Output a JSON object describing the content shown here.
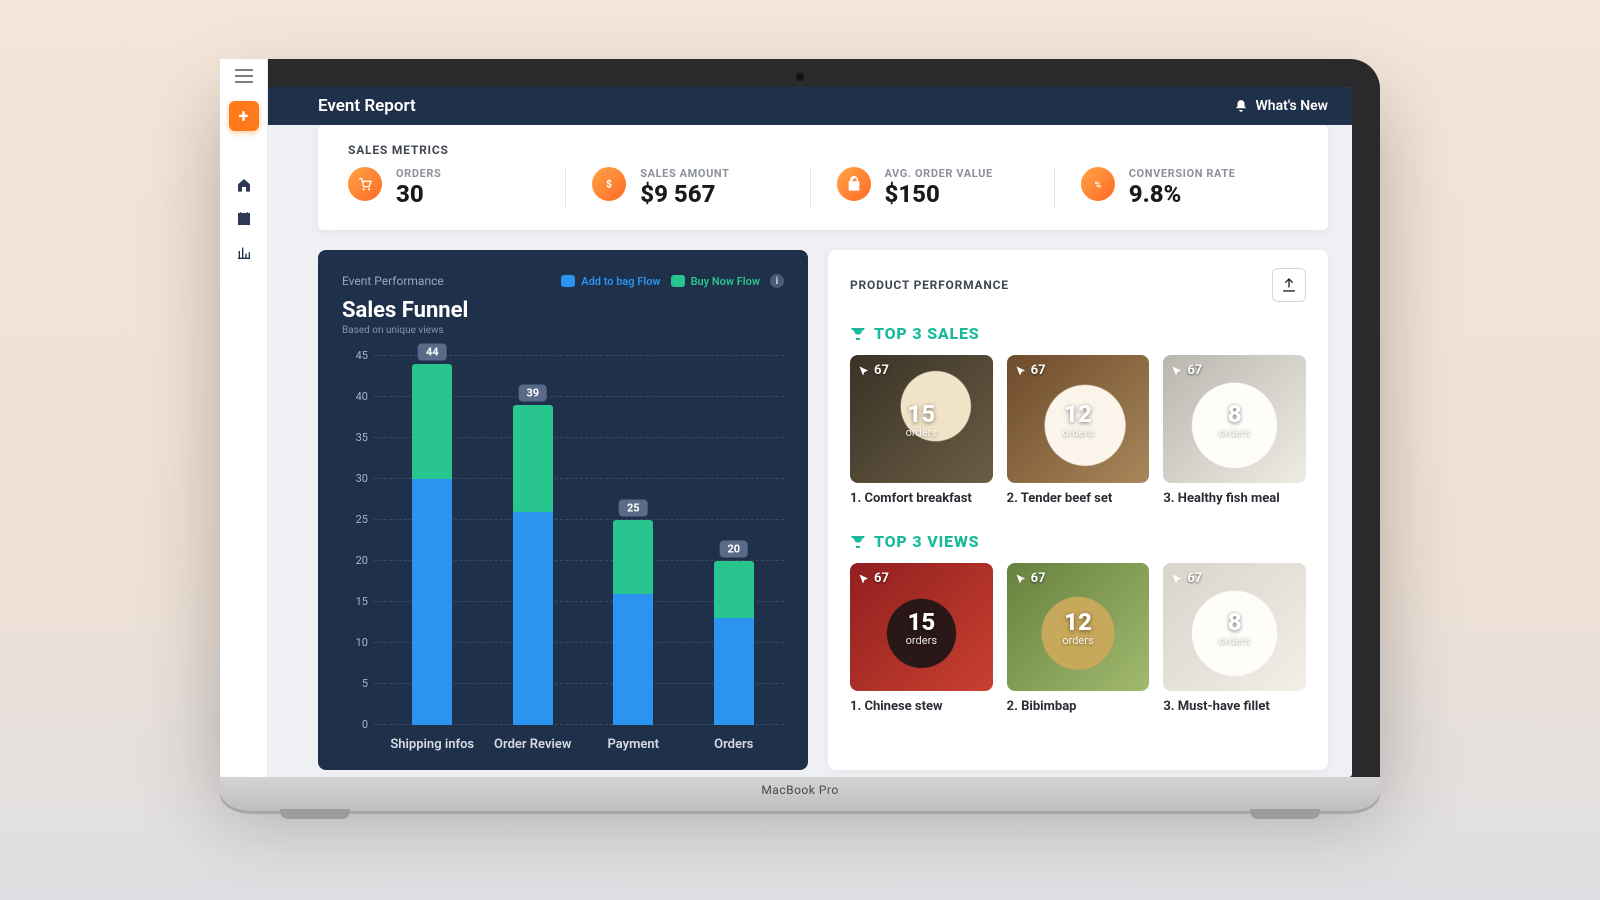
{
  "header": {
    "title": "Event Report",
    "whats_new": "What's New"
  },
  "metrics": {
    "section_label": "SALES METRICS",
    "items": [
      {
        "label": "ORDERS",
        "value": "30"
      },
      {
        "label": "SALES AMOUNT",
        "value": "$9 567"
      },
      {
        "label": "AVG. ORDER VALUE",
        "value": "$150"
      },
      {
        "label": "CONVERSION RATE",
        "value": "9.8%"
      }
    ]
  },
  "chart": {
    "perf_label": "Event Performance",
    "legend_a": "Add to bag Flow",
    "legend_b": "Buy Now Flow",
    "title": "Sales Funnel",
    "subtitle": "Based on unique views"
  },
  "chart_data": {
    "type": "bar",
    "stacked": true,
    "categories": [
      "Shipping infos",
      "Order Review",
      "Payment",
      "Orders"
    ],
    "series": [
      {
        "name": "Add to bag Flow",
        "color": "#2b93f0",
        "values": [
          30,
          26,
          16,
          13
        ]
      },
      {
        "name": "Buy Now Flow",
        "color": "#29c58f",
        "values": [
          14,
          13,
          9,
          7
        ]
      }
    ],
    "totals": [
      44,
      39,
      25,
      20
    ],
    "ylim": [
      0,
      45
    ],
    "yticks": [
      0,
      5,
      10,
      15,
      20,
      25,
      30,
      35,
      40,
      45
    ],
    "title": "Sales Funnel",
    "xlabel": "",
    "ylabel": ""
  },
  "products": {
    "section_label": "PRODUCT PERFORMANCE",
    "top_sales_label": "TOP 3 SALES",
    "top_views_label": "TOP 3 VIEWS",
    "top_sales": [
      {
        "rank": "1.",
        "name": "Comfort breakfast",
        "views": "67",
        "orders": "15",
        "orders_label": "orders"
      },
      {
        "rank": "2.",
        "name": "Tender beef set",
        "views": "67",
        "orders": "12",
        "orders_label": "orders"
      },
      {
        "rank": "3.",
        "name": "Healthy fish meal",
        "views": "67",
        "orders": "8",
        "orders_label": "orders"
      }
    ],
    "top_views": [
      {
        "rank": "1.",
        "name": "Chinese stew",
        "views": "67",
        "orders": "15",
        "orders_label": "orders"
      },
      {
        "rank": "2.",
        "name": "Bibimbap",
        "views": "67",
        "orders": "12",
        "orders_label": "orders"
      },
      {
        "rank": "3.",
        "name": "Must-have fillet",
        "views": "67",
        "orders": "8",
        "orders_label": "orders"
      }
    ]
  },
  "laptop_brand": "MacBook Pro"
}
